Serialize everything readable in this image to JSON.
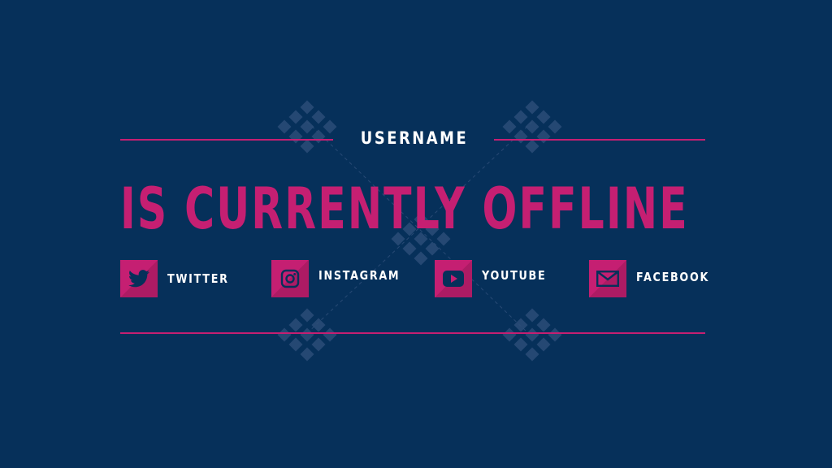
{
  "overlay": {
    "username": "USERNAME",
    "headline": "IS CURRENTLY OFFLINE"
  },
  "socials": [
    {
      "label": "TWITTER",
      "icon": "twitter-bird-icon"
    },
    {
      "label": "INSTAGRAM",
      "icon": "instagram-camera-icon"
    },
    {
      "label": "YOUTUBE",
      "icon": "youtube-play-icon"
    },
    {
      "label": "FACEBOOK",
      "icon": "mail-envelope-icon"
    }
  ],
  "colors": {
    "background": "#06305a",
    "accent": "#c51f72",
    "text": "#ffffff",
    "pattern": "#2c4d78"
  }
}
